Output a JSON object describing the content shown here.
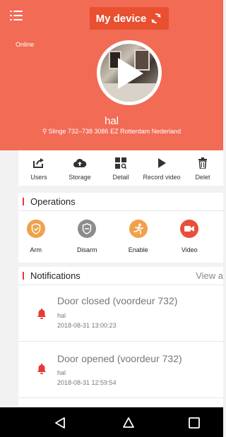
{
  "header": {
    "title": "My device",
    "status": "Online",
    "device_name": "hal",
    "address": "Slinge 732–738 3086 EZ Rotterdam Nederland",
    "background_color": "#f26b55",
    "title_bg_color": "#e8502f"
  },
  "icons": {
    "menu": "menu-icon",
    "refresh": "refresh-icon",
    "play": "play-icon",
    "location": "location-pin-icon"
  },
  "toolbar": {
    "items": [
      {
        "label": "Users",
        "icon": "share-icon"
      },
      {
        "label": "Storage",
        "icon": "cloud-upload-icon"
      },
      {
        "label": "Detail",
        "icon": "detail-grid-icon"
      },
      {
        "label": "Record video",
        "icon": "play-triangle-icon"
      },
      {
        "label": "Delet",
        "icon": "trash-icon"
      }
    ]
  },
  "operations": {
    "title": "Operations",
    "items": [
      {
        "label": "Arm",
        "icon": "shield-check-icon",
        "color": "#f0a24a"
      },
      {
        "label": "Disarm",
        "icon": "shield-minus-icon",
        "color": "#8c8c8c"
      },
      {
        "label": "Enable",
        "icon": "running-person-icon",
        "color": "#f0a24a"
      },
      {
        "label": "Video",
        "icon": "video-camera-icon",
        "color": "#e8503a"
      }
    ]
  },
  "notifications": {
    "title": "Notifications",
    "view_all": "View a",
    "items": [
      {
        "title": "Door closed (voordeur 732)",
        "device": "hal",
        "time": "2018-08-31 13:00:23"
      },
      {
        "title": "Door opened (voordeur 732)",
        "device": "hal",
        "time": "2018-08-31 12:59:54"
      }
    ],
    "bell_color": "#e53935"
  },
  "navbar": {
    "back": "back-triangle-icon",
    "home": "home-circle-icon",
    "recent": "recent-square-icon"
  }
}
